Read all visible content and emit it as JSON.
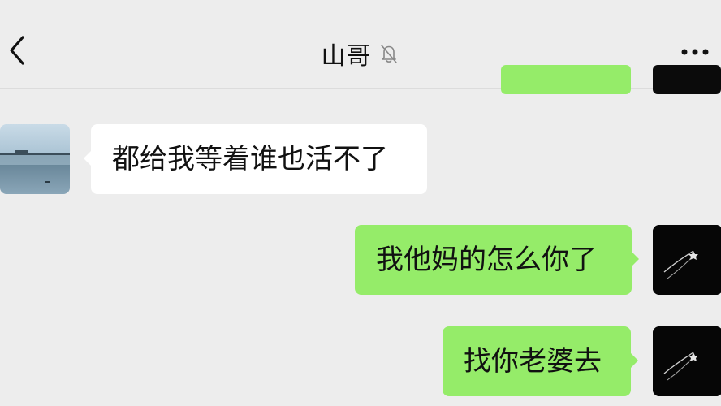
{
  "header": {
    "title": "山哥",
    "back_icon": "chevron-left-icon",
    "mute_icon": "bell-off-icon",
    "more_icon": "more-dots-icon"
  },
  "messages": [
    {
      "side": "left",
      "text": "都给我等着谁也活不了",
      "avatar": "landscape-lake-avatar"
    },
    {
      "side": "right",
      "text": "我他妈的怎么你了",
      "avatar": "dark-star-avatar"
    },
    {
      "side": "right",
      "text": "找你老婆去",
      "avatar": "dark-star-avatar"
    }
  ],
  "colors": {
    "background": "#ededed",
    "sent_bubble": "#95ec69",
    "received_bubble": "#ffffff"
  }
}
